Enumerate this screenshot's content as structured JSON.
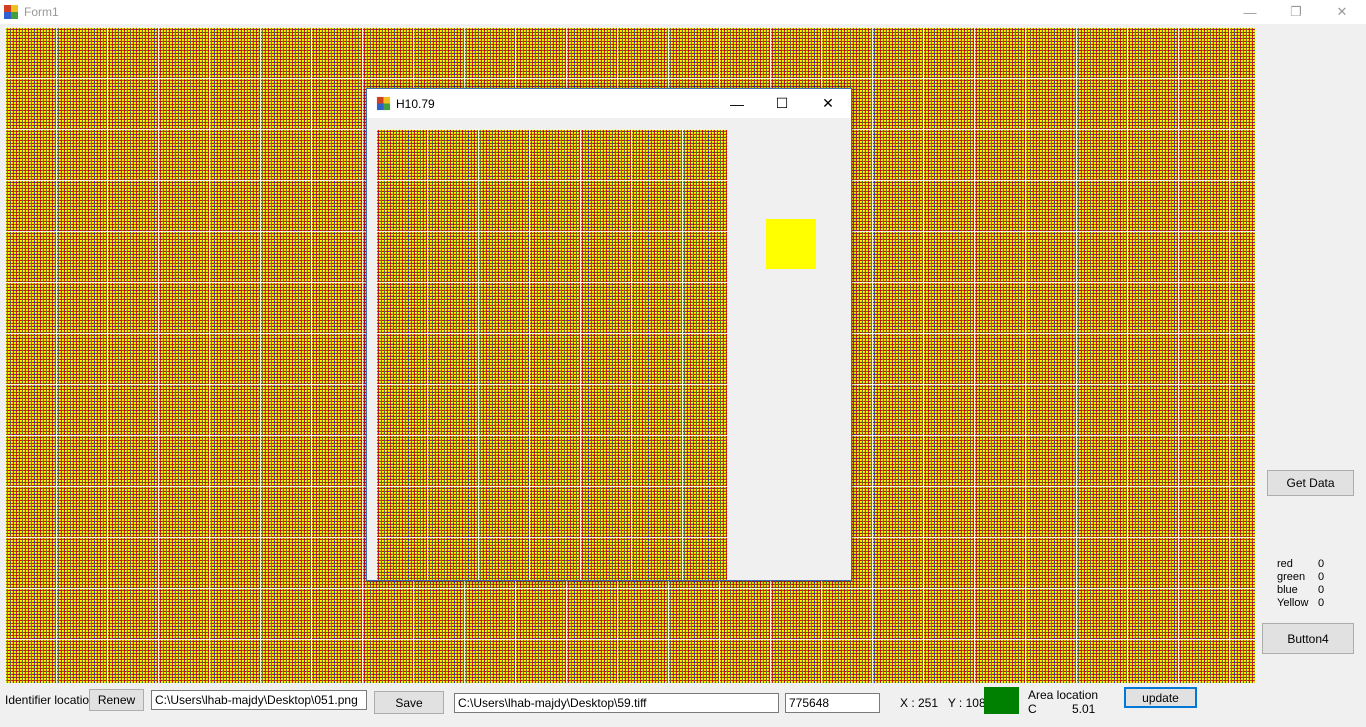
{
  "main_window": {
    "title": "Form1",
    "minimize_glyph": "—",
    "restore_glyph": "❐",
    "close_glyph": "✕"
  },
  "child_window": {
    "title": "H10.79",
    "minimize_glyph": "—",
    "maximize_glyph": "☐",
    "close_glyph": "✕",
    "swatch_color": "#ffff00"
  },
  "side_panel": {
    "get_data_label": "Get Data",
    "button4_label": "Button4",
    "stats": [
      {
        "name": "red",
        "value": "0"
      },
      {
        "name": "green",
        "value": "0"
      },
      {
        "name": "blue",
        "value": "0"
      },
      {
        "name": "Yellow",
        "value": "0"
      }
    ]
  },
  "bottom_bar": {
    "identifier_label": "Identifier location",
    "renew_label": "Renew",
    "source_path": "C:\\Users\\lhab-majdy\\Desktop\\051.png",
    "save_label": "Save",
    "save_path": "C:\\Users\\lhab-majdy\\Desktop\\59.tiff",
    "number_value": "775648",
    "coords_text": "X : 251   Y : 108",
    "area_swatch_color": "#008000",
    "area_label": "Area location",
    "area_code": "C",
    "area_value": "5.01",
    "update_label": "update"
  },
  "colors": {
    "canvas_red": "#e00000",
    "canvas_green": "#1a8a1a",
    "canvas_blue": "#2a2ad0",
    "canvas_yellow": "#ffff00",
    "grid_line": "#ffffff"
  }
}
